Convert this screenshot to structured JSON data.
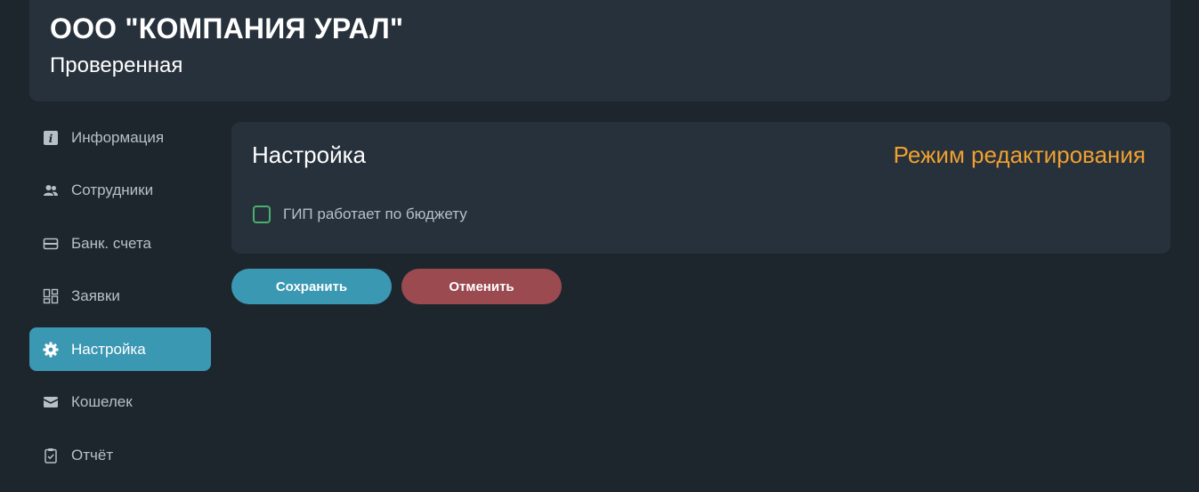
{
  "header": {
    "company_name": "ООО \"КОМПАНИЯ УРАЛ\"",
    "status": "Проверенная"
  },
  "sidebar": {
    "items": [
      {
        "label": "Информация",
        "icon": "info-icon",
        "active": false
      },
      {
        "label": "Сотрудники",
        "icon": "people-icon",
        "active": false
      },
      {
        "label": "Банк. счета",
        "icon": "card-icon",
        "active": false
      },
      {
        "label": "Заявки",
        "icon": "grid-icon",
        "active": false
      },
      {
        "label": "Настройка",
        "icon": "gear-icon",
        "active": true
      },
      {
        "label": "Кошелек",
        "icon": "wallet-icon",
        "active": false
      },
      {
        "label": "Отчёт",
        "icon": "clipboard-icon",
        "active": false
      }
    ]
  },
  "settings_panel": {
    "title": "Настройка",
    "edit_mode_label": "Режим редактирования",
    "checkbox_label": "ГИП работает по бюджету",
    "checkbox_checked": false
  },
  "actions": {
    "save_label": "Сохранить",
    "cancel_label": "Отменить"
  },
  "colors": {
    "background": "#1d252d",
    "card": "#27313b",
    "accent": "#3b98b3",
    "edit_mode": "#f0a030",
    "cancel": "#9b4a50",
    "checkbox_border": "#4caf6e"
  }
}
